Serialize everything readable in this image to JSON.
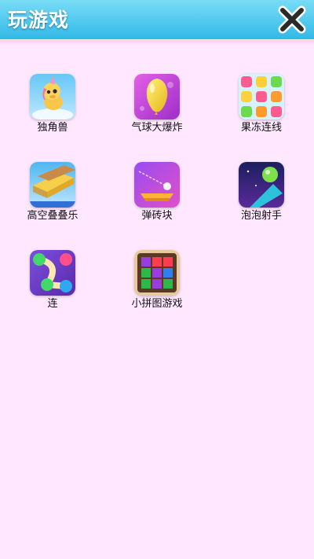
{
  "header": {
    "title": "玩游戏"
  },
  "games": [
    {
      "label": "独角兽",
      "icon": "unicorn-icon"
    },
    {
      "label": "气球大爆炸",
      "icon": "balloon-icon"
    },
    {
      "label": "果冻连线",
      "icon": "jelly-icon"
    },
    {
      "label": "高空叠叠乐",
      "icon": "stack-icon"
    },
    {
      "label": "弹砖块",
      "icon": "brick-ball-icon"
    },
    {
      "label": "泡泡射手",
      "icon": "bubble-shooter-icon"
    },
    {
      "label": "连",
      "icon": "connect-dots-icon"
    },
    {
      "label": "小拼图游戏",
      "icon": "block-puzzle-icon"
    }
  ],
  "colors": {
    "header": "#4ec7ee",
    "background": "#ffe8ff"
  }
}
